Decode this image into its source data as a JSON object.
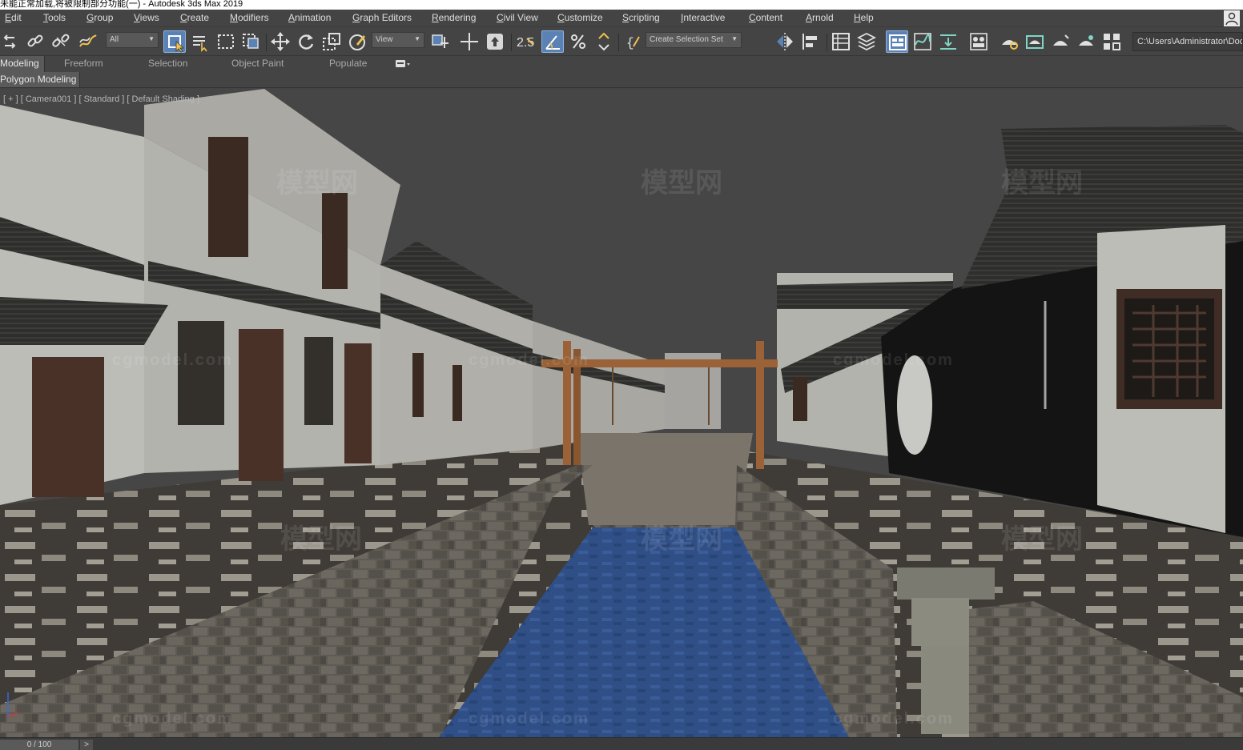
{
  "window": {
    "title": "未能正常加载,将被限制部分功能(一) - Autodesk 3ds Max 2019"
  },
  "menu": {
    "items": [
      "Edit",
      "Tools",
      "Group",
      "Views",
      "Create",
      "Modifiers",
      "Animation",
      "Graph Editors",
      "Rendering",
      "Civil View",
      "Customize",
      "Scripting",
      "Interactive",
      "Content",
      "Arnold",
      "Help"
    ]
  },
  "toolbar": {
    "selection_filter": "All",
    "reference_coord": "View",
    "named_selection": "Create Selection Set",
    "project_path": "C:\\Users\\Administrator\\Doc",
    "snap_toggle": "2.5",
    "icons": [
      "undo-icon",
      "link-icon",
      "unlink-icon",
      "bind-space-warp-icon",
      "select-object-icon",
      "select-by-name-icon",
      "rectangular-selection-icon",
      "window-crossing-icon",
      "move-icon",
      "rotate-icon",
      "scale-icon",
      "place-icon",
      "pivot-icon",
      "manipulate-icon",
      "keyboard-shortcut-icon",
      "snaps-icon",
      "angle-snap-icon",
      "percent-snap-icon",
      "spinner-snap-icon",
      "edit-named-selection-icon",
      "mirror-icon",
      "align-icon",
      "scene-explorer-icon",
      "layer-explorer-icon",
      "ribbon-toggle-icon",
      "curve-editor-icon",
      "schematic-view-icon",
      "material-editor-icon",
      "render-setup-icon",
      "rendered-frame-icon",
      "render-production-icon",
      "render-iterative-icon",
      "render-activeshade-icon",
      "render-online-icon"
    ]
  },
  "ribbon": {
    "tabs": [
      "Modeling",
      "Freeform",
      "Selection",
      "Object Paint",
      "Populate"
    ],
    "active_tab": "Modeling",
    "sub_panel": "Polygon Modeling"
  },
  "viewport": {
    "label": "[ + ] [ Camera001 ] [ Standard ] [ Default Shading ]",
    "watermark_logo": "模型网",
    "watermark_site": "cgmodel.com",
    "scene_colors": {
      "sky": "#464646",
      "water": "#2f4f86",
      "stone": "#5e5a54",
      "wall": "#bdbdb8",
      "roof": "#2e2e2c",
      "wood": "#9a6236",
      "ground": "#3f3b36"
    }
  },
  "timebar": {
    "frame": "0 / 100",
    "next_label": ">"
  }
}
